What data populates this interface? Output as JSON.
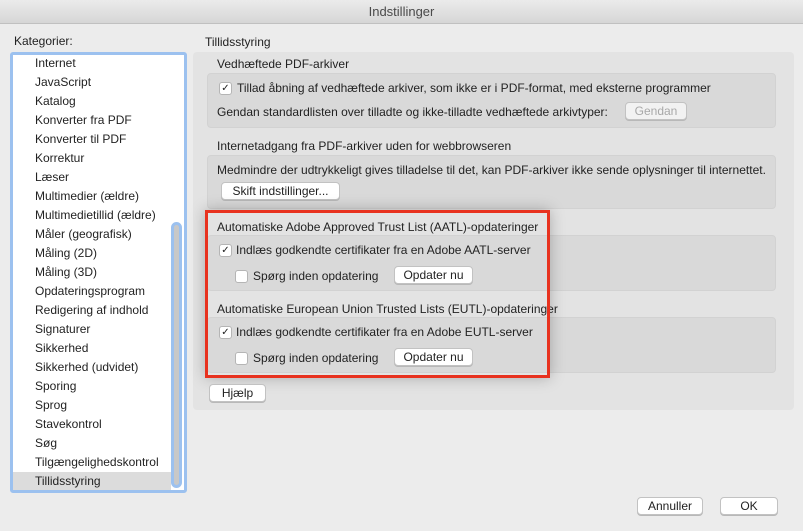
{
  "window": {
    "title": "Indstillinger"
  },
  "sidebar": {
    "label": "Kategorier:",
    "items": [
      "Internet",
      "JavaScript",
      "Katalog",
      "Konverter fra PDF",
      "Konverter til PDF",
      "Korrektur",
      "Læser",
      "Multimedier (ældre)",
      "Multimedietillid (ældre)",
      "Måler (geografisk)",
      "Måling (2D)",
      "Måling (3D)",
      "Opdateringsprogram",
      "Redigering af indhold",
      "Signaturer",
      "Sikkerhed",
      "Sikkerhed (udvidet)",
      "Sporing",
      "Sprog",
      "Stavekontrol",
      "Søg",
      "Tilgængelighedskontrol",
      "Tillidsstyring"
    ],
    "selected": "Tillidsstyring"
  },
  "main": {
    "title": "Tillidsstyring",
    "attachments": {
      "title": "Vedhæftede PDF-arkiver",
      "allow_label": "Tillad åbning af vedhæftede arkiver, som ikke er i PDF-format, med eksterne programmer",
      "allow_checked": true,
      "restore_label": "Gendan standardlisten over tilladte og ikke-tilladte vedhæftede arkivtyper:",
      "restore_button": "Gendan"
    },
    "internet": {
      "title": "Internetadgang fra PDF-arkiver uden for webbrowseren",
      "text": "Medmindre der udtrykkeligt gives tilladelse til det, kan PDF-arkiver ikke sende oplysninger til internettet.",
      "button": "Skift indstillinger..."
    },
    "aatl": {
      "title": "Automatiske Adobe Approved Trust List (AATL)-opdateringer",
      "load_label": "Indlæs godkendte certifikater fra en Adobe AATL-server",
      "load_checked": true,
      "ask_label": "Spørg inden opdatering",
      "ask_checked": false,
      "update_button": "Opdater nu"
    },
    "eutl": {
      "title": "Automatiske European Union Trusted Lists (EUTL)-opdateringer",
      "load_label": "Indlæs godkendte certifikater fra en Adobe EUTL-server",
      "load_checked": true,
      "ask_label": "Spørg inden opdatering",
      "ask_checked": false,
      "update_button": "Opdater nu"
    },
    "help_button": "Hjælp"
  },
  "footer": {
    "cancel": "Annuller",
    "ok": "OK"
  },
  "check_glyph": "✓"
}
